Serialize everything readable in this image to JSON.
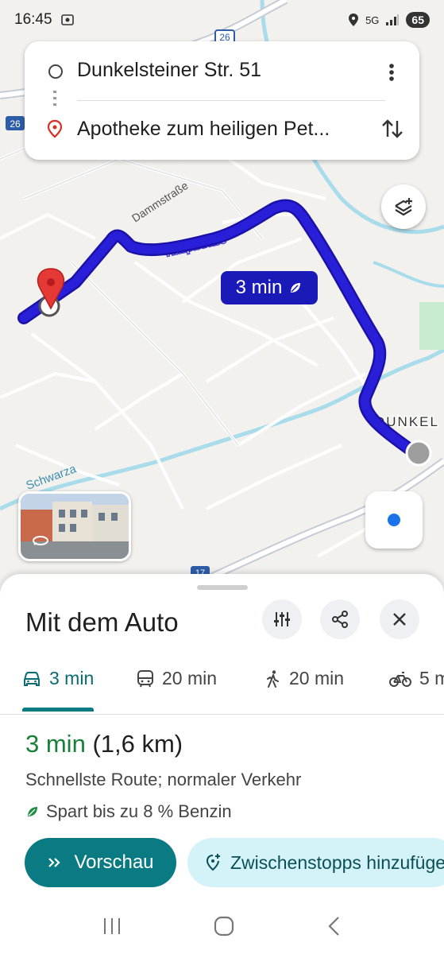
{
  "status_bar": {
    "time": "16:45",
    "network": "5G",
    "battery": "65"
  },
  "route_card": {
    "origin": "Dunkelsteiner Str. 51",
    "destination": "Apotheke zum heiligen Pet..."
  },
  "map": {
    "route_badge": "3 min",
    "road_labels": {
      "dammstrasse": "Dammstraße",
      "hauptstrasse": "Hauptstraße",
      "schwarza": "Schwarza",
      "dunkel": "DUNKEL"
    },
    "road_shields": [
      "26",
      "26",
      "17"
    ],
    "route_color": "#2a1fd9"
  },
  "sheet": {
    "title": "Mit dem Auto",
    "tabs": [
      {
        "mode": "car",
        "label": "3 min"
      },
      {
        "mode": "transit",
        "label": "20 min"
      },
      {
        "mode": "walk",
        "label": "20 min"
      },
      {
        "mode": "bike",
        "label": "5 m"
      }
    ],
    "duration": "3 min",
    "distance": "(1,6 km)",
    "description": "Schnellste Route; normaler Verkehr",
    "eco": "Spart bis zu 8 % Benzin",
    "preview_label": "Vorschau",
    "add_stops_label": "Zwischenstopps hinzufügen"
  },
  "colors": {
    "accent": "#0b7b83",
    "duration_green": "#188038",
    "route": "#2a1fd9"
  }
}
